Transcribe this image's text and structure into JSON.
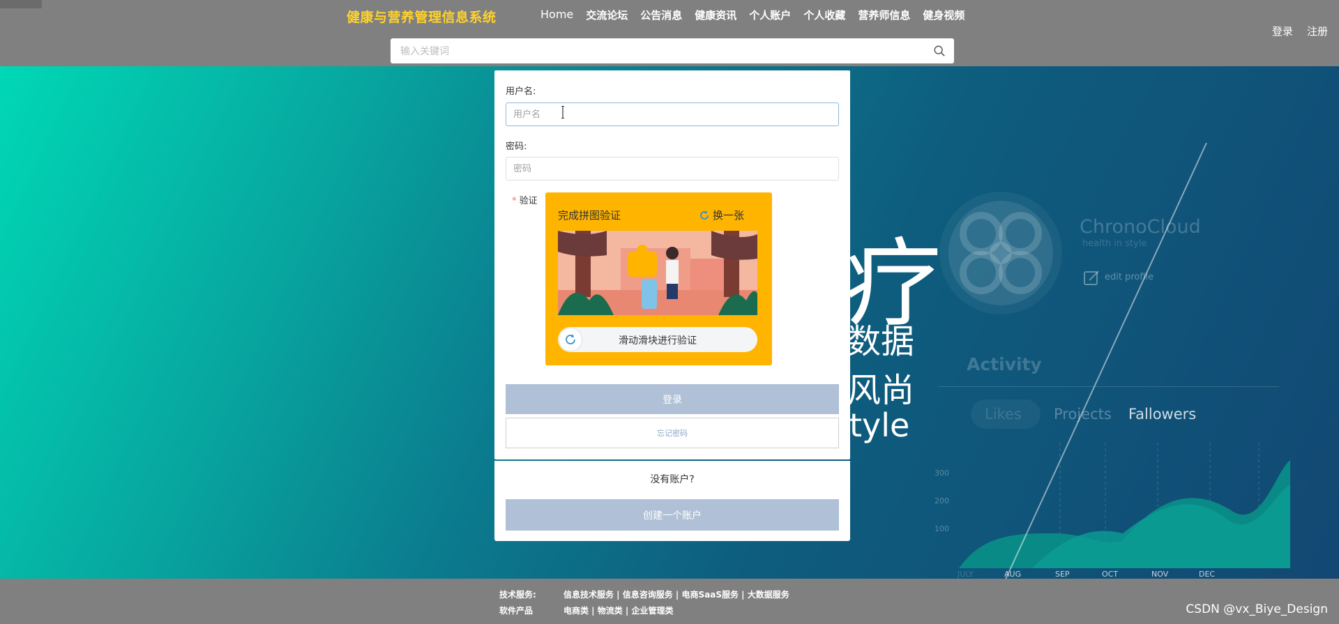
{
  "header": {
    "site_title": "健康与营养管理信息系统",
    "nav": [
      "Home",
      "交流论坛",
      "公告消息",
      "健康资讯",
      "个人账户",
      "个人收藏",
      "营养师信息",
      "健身视频"
    ],
    "login": "登录",
    "register": "注册",
    "search_placeholder": "输入关键词"
  },
  "background": {
    "glyph_big": "疗",
    "line_data": "数据",
    "line_fashion": "风尚",
    "line_style": "tyle",
    "brand_name": "ChronoCloud",
    "brand_tagline": "health in style",
    "edit_profile": "edit profile",
    "activity": "Activity",
    "tabs": [
      "Likes",
      "Projects",
      "Fallowers"
    ],
    "y_ticks": [
      "300",
      "200",
      "100"
    ],
    "months": [
      "JULY",
      "AUG",
      "SEP",
      "OCT",
      "NOV",
      "DEC"
    ]
  },
  "login_form": {
    "username_label": "用户名:",
    "username_placeholder": "用户名",
    "password_label": "密码:",
    "password_placeholder": "密码",
    "verify_required": "*",
    "verify_label": "验证",
    "captcha_title": "完成拼图验证",
    "captcha_refresh": "换一张",
    "slider_text": "滑动滑块进行验证",
    "login_button": "登录",
    "forgot_button": "忘记密码",
    "no_account": "没有账户?",
    "create_button": "创建一个账户"
  },
  "footer": {
    "rows": [
      {
        "key": "技术服务:",
        "value": "信息技术服务 | 信息咨询服务 | 电商SaaS服务 | 大数据服务"
      },
      {
        "key": "软件产品",
        "value": "电商类 | 物流类 | 企业管理类"
      }
    ]
  },
  "watermark": "CSDN @vx_Biye_Design",
  "colors": {
    "title": "#ffd22b",
    "captcha": "#ffb400",
    "button": "#b0c0d6",
    "header": "#808080"
  }
}
